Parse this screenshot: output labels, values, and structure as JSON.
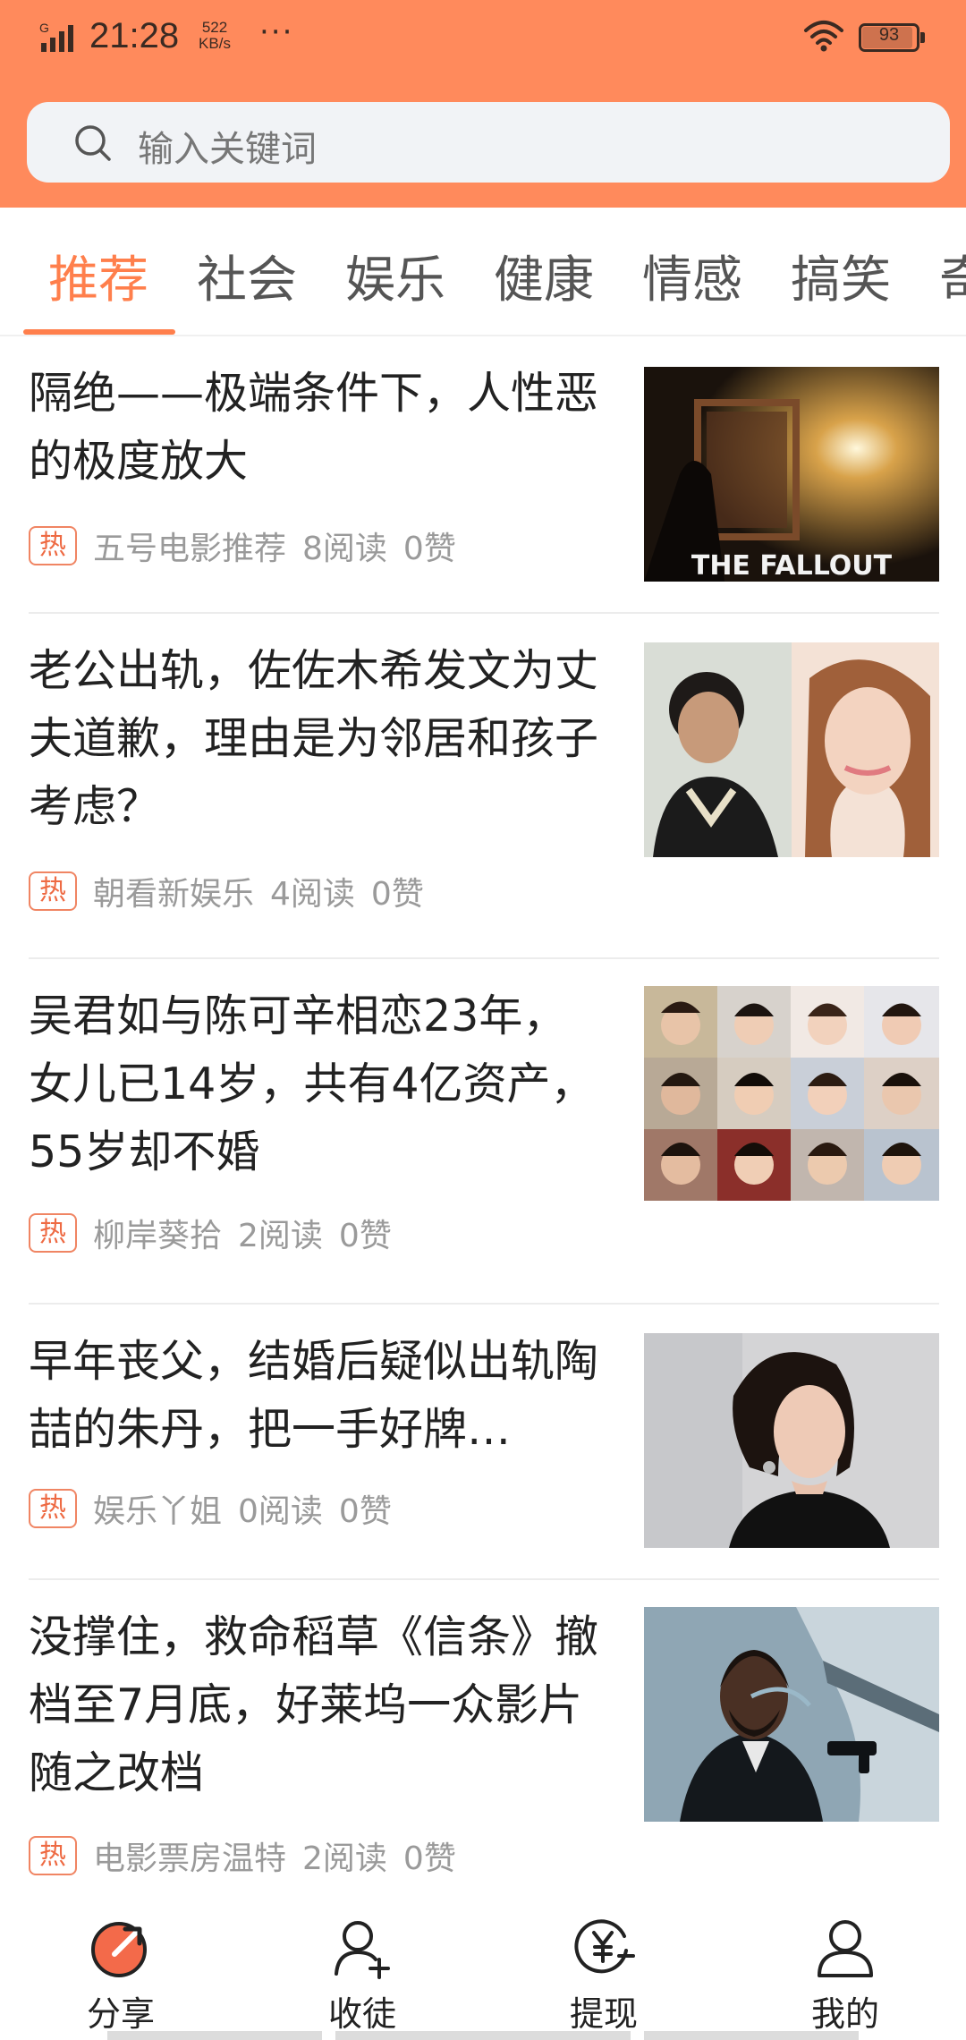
{
  "status_bar": {
    "network": "G",
    "time": "21:28",
    "speed_value": "522",
    "speed_unit": "KB/s",
    "more": "···",
    "battery_percent": 93,
    "battery_label": "93"
  },
  "search": {
    "placeholder": "输入关键词"
  },
  "tabs": [
    {
      "label": "推荐",
      "active": true
    },
    {
      "label": "社会"
    },
    {
      "label": "娱乐"
    },
    {
      "label": "健康"
    },
    {
      "label": "情感"
    },
    {
      "label": "搞笑"
    },
    {
      "label": "奇"
    }
  ],
  "articles": [
    {
      "title": "隔绝——极端条件下，人性恶的极度放大",
      "hot": "热",
      "source": "五号电影推荐",
      "reads": "8阅读",
      "likes": "0赞",
      "thumb_caption": "THE FALLOUT"
    },
    {
      "title": "老公出轨，佐佐木希发文为丈夫道歉，理由是为邻居和孩子考虑？",
      "hot": "热",
      "source": "朝看新娱乐",
      "reads": "4阅读",
      "likes": "0赞"
    },
    {
      "title": "吴君如与陈可辛相恋23年，女儿已14岁，共有4亿资产，55岁却不婚",
      "hot": "热",
      "source": "柳岸葵拾",
      "reads": "2阅读",
      "likes": "0赞"
    },
    {
      "title": "早年丧父，结婚后疑似出轨陶喆的朱丹，把一手好牌…",
      "hot": "热",
      "source": "娱乐丫姐",
      "reads": "0阅读",
      "likes": "0赞"
    },
    {
      "title": "没撑住，救命稻草《信条》撤档至7月底，好莱坞一众影片随之改档",
      "hot": "热",
      "source": "电影票房温特",
      "reads": "2阅读",
      "likes": "0赞"
    }
  ],
  "bottom_nav": [
    {
      "label": "分享",
      "icon": "share-icon"
    },
    {
      "label": "收徒",
      "icon": "add-user-icon"
    },
    {
      "label": "提现",
      "icon": "withdraw-icon"
    },
    {
      "label": "我的",
      "icon": "profile-icon"
    }
  ],
  "colors": {
    "header": "#ff8a5c",
    "accent": "#ff7f4c",
    "hot": "#ee6a43"
  }
}
